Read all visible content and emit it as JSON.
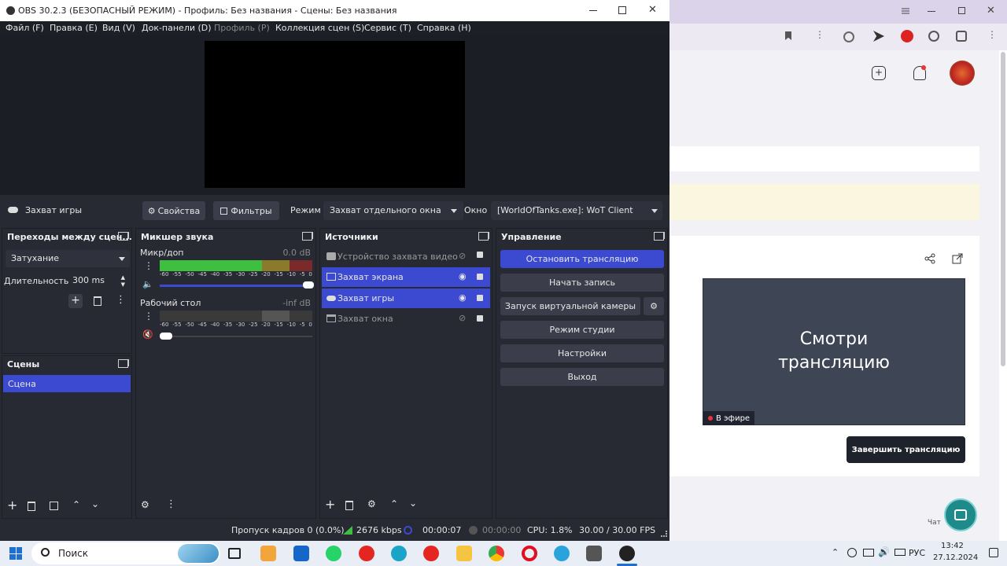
{
  "window": {
    "title": "OBS 30.2.3 (БЕЗОПАСНЫЙ РЕЖИМ) - Профиль: Без названия - Сцены: Без названия"
  },
  "menu": [
    "Файл (F)",
    "Правка (E)",
    "Вид (V)",
    "Док-панели (D)",
    "Профиль (P)",
    "Коллекция сцен (S)",
    "Сервис (T)",
    "Справка (H)"
  ],
  "source_bar": {
    "selected_source": "Захват игры",
    "properties_label": "Свойства",
    "filters_label": "Фильтры",
    "mode_label": "Режим",
    "mode_value": "Захват отдельного окна",
    "window_label": "Окно",
    "window_value": "[WorldOfTanks.exe]: WoT Client"
  },
  "transitions": {
    "title": "Переходы между сцен...",
    "transition_value": "Затухание",
    "duration_label": "Длительность",
    "duration_value": "300 ms"
  },
  "mixer": {
    "title": "Микшер звука",
    "channels": [
      {
        "name": "Микр/доп",
        "db": "0.0 dB",
        "level": 0.62
      },
      {
        "name": "Рабочий стол",
        "db": "-inf dB",
        "level": 0.0
      }
    ],
    "ticks": [
      "-60",
      "-55",
      "-50",
      "-45",
      "-40",
      "-35",
      "-30",
      "-25",
      "-20",
      "-15",
      "-10",
      "-5",
      "0"
    ]
  },
  "sources": {
    "title": "Источники",
    "items": [
      {
        "name": "Устройство захвата видео",
        "visible": false,
        "selected": false,
        "icon": "camera-icon"
      },
      {
        "name": "Захват экрана",
        "visible": true,
        "selected": true,
        "icon": "monitor-icon"
      },
      {
        "name": "Захват игры",
        "visible": true,
        "selected": true,
        "icon": "gamepad-icon"
      },
      {
        "name": "Захват окна",
        "visible": false,
        "selected": false,
        "icon": "window-icon"
      }
    ]
  },
  "controls": {
    "title": "Управление",
    "stop_stream": "Остановить трансляцию",
    "start_record": "Начать запись",
    "virtual_camera": "Запуск виртуальной камеры",
    "studio_mode": "Режим студии",
    "settings": "Настройки",
    "exit": "Выход"
  },
  "scenes": {
    "title": "Сцены",
    "items": [
      "Сцена"
    ]
  },
  "status": {
    "dropped_frames": "Пропуск кадров 0 (0.0%)",
    "bitrate": "2676 kbps",
    "stream_time": "00:00:07",
    "record_time": "00:00:00",
    "cpu": "CPU: 1.8%",
    "fps": "30.00 / 30.00 FPS"
  },
  "browser": {
    "preview_title": "Смотри\nтрансляцию",
    "live_badge": "В эфире",
    "end_stream_button": "Завершить трансляцию",
    "chat_label": "Чат"
  },
  "taskbar": {
    "search_placeholder": "Поиск",
    "language": "РУС",
    "time": "13:42",
    "date": "27.12.2024"
  },
  "colors": {
    "accent": "#3c4ad1",
    "obs_bg": "#272a33",
    "meter_green": "#3fbf3f",
    "meter_yellow": "#c9b13a",
    "meter_red": "#c43a3a"
  }
}
